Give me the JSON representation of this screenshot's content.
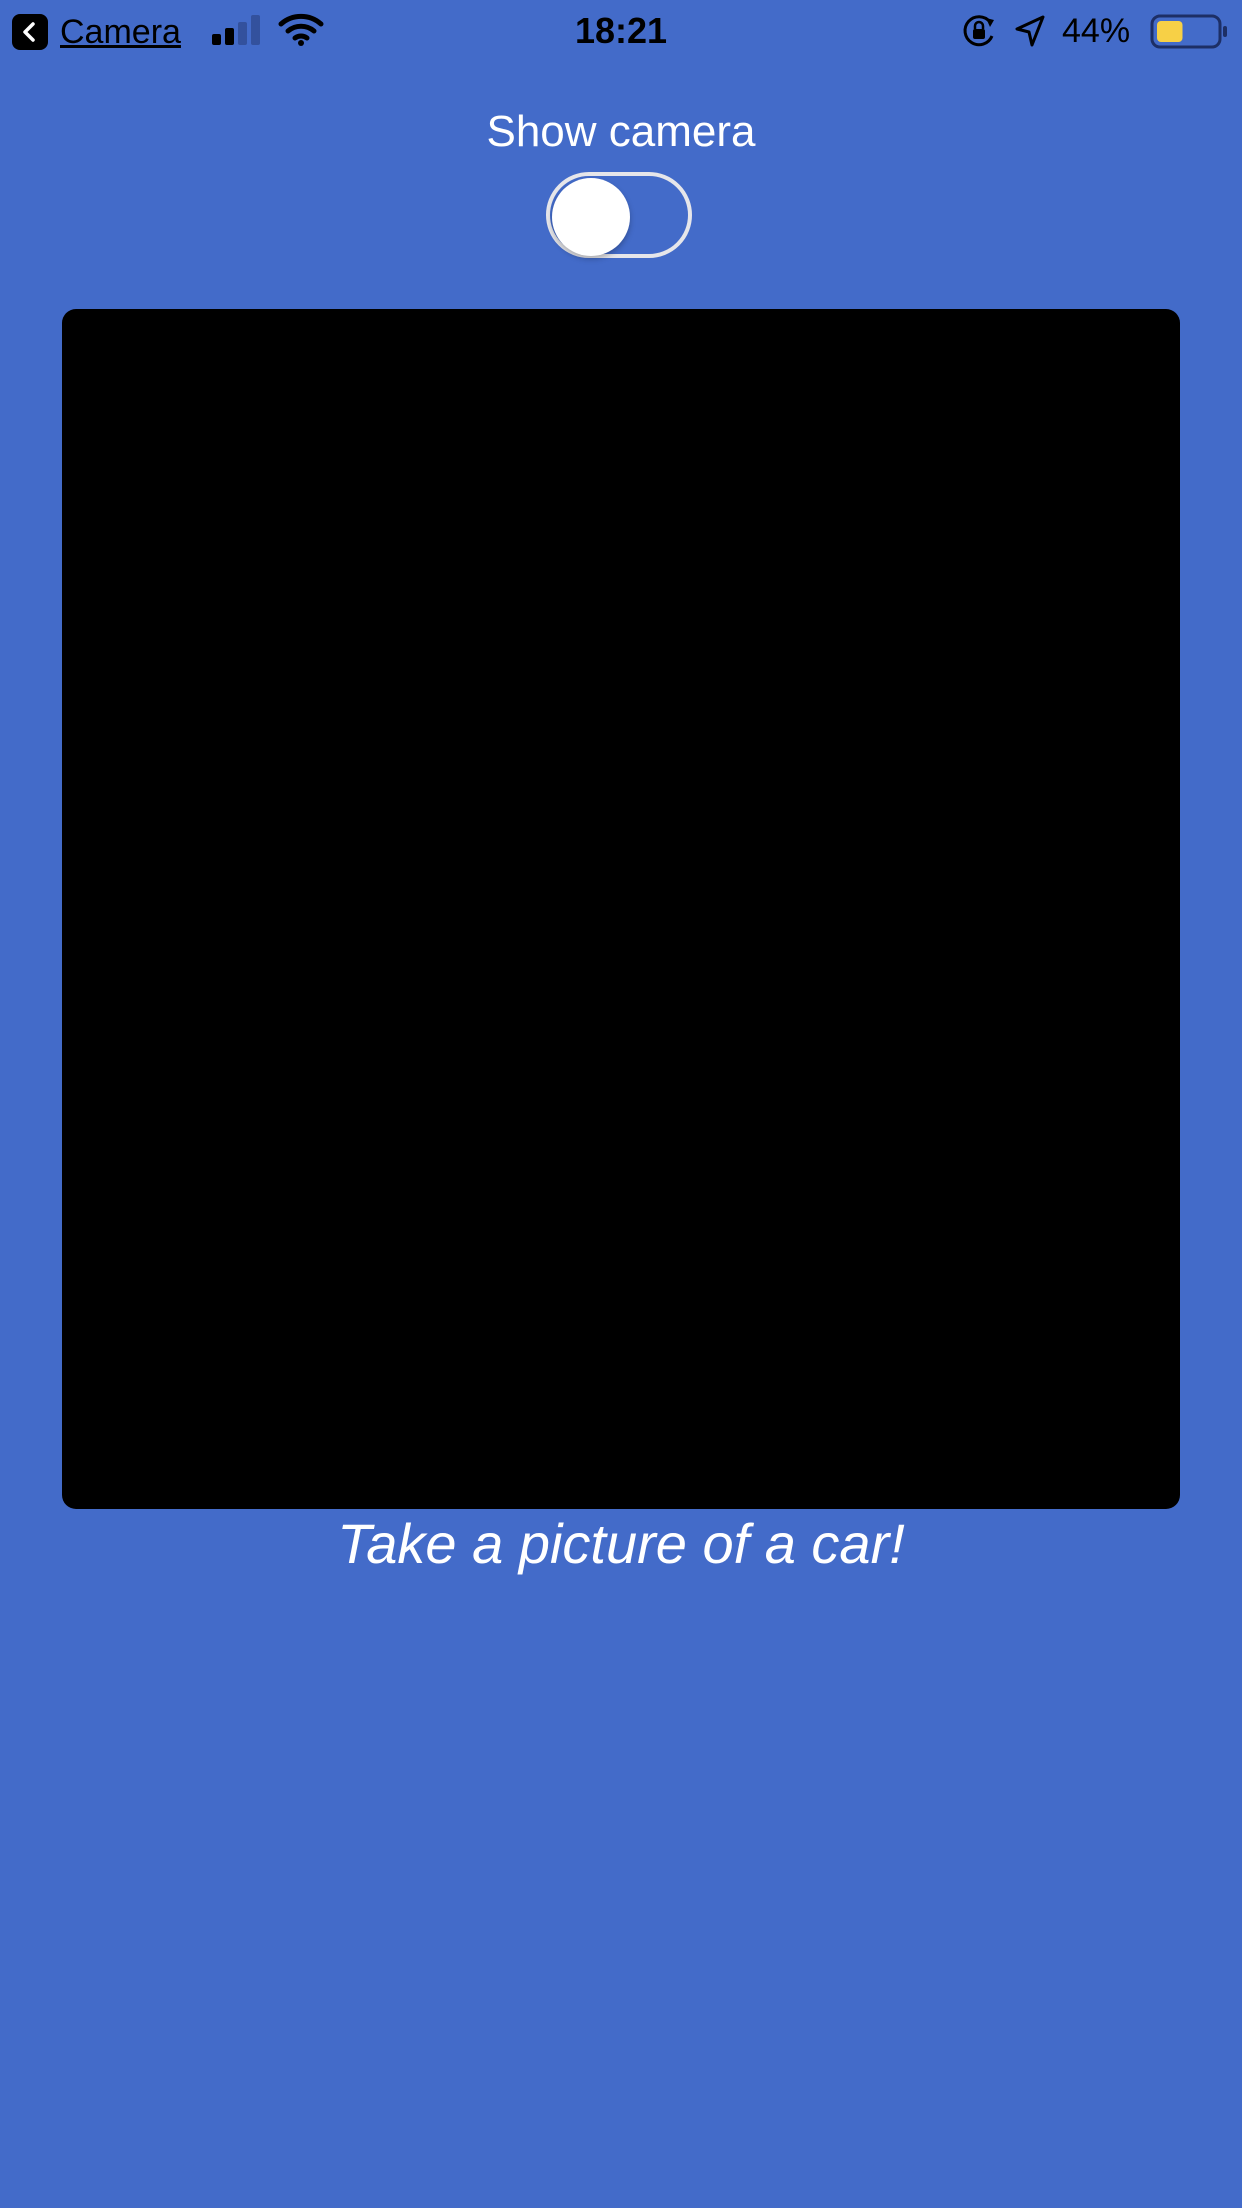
{
  "status_bar": {
    "back_app_label": "Camera",
    "time": "18:21",
    "battery_percent": "44%",
    "battery_level": 0.44,
    "signal_bars_active": 2,
    "signal_bars_total": 4,
    "icons": [
      "back-chevron-icon",
      "cellular-signal-icon",
      "wifi-icon",
      "rotation-lock-icon",
      "location-arrow-icon",
      "battery-icon"
    ]
  },
  "camera_toggle": {
    "label": "Show camera",
    "state": "off"
  },
  "caption": "Take a picture of a car!",
  "colors": {
    "background": "#436bc9",
    "camera_preview": "#000000",
    "battery_fill": "#f7d046"
  }
}
